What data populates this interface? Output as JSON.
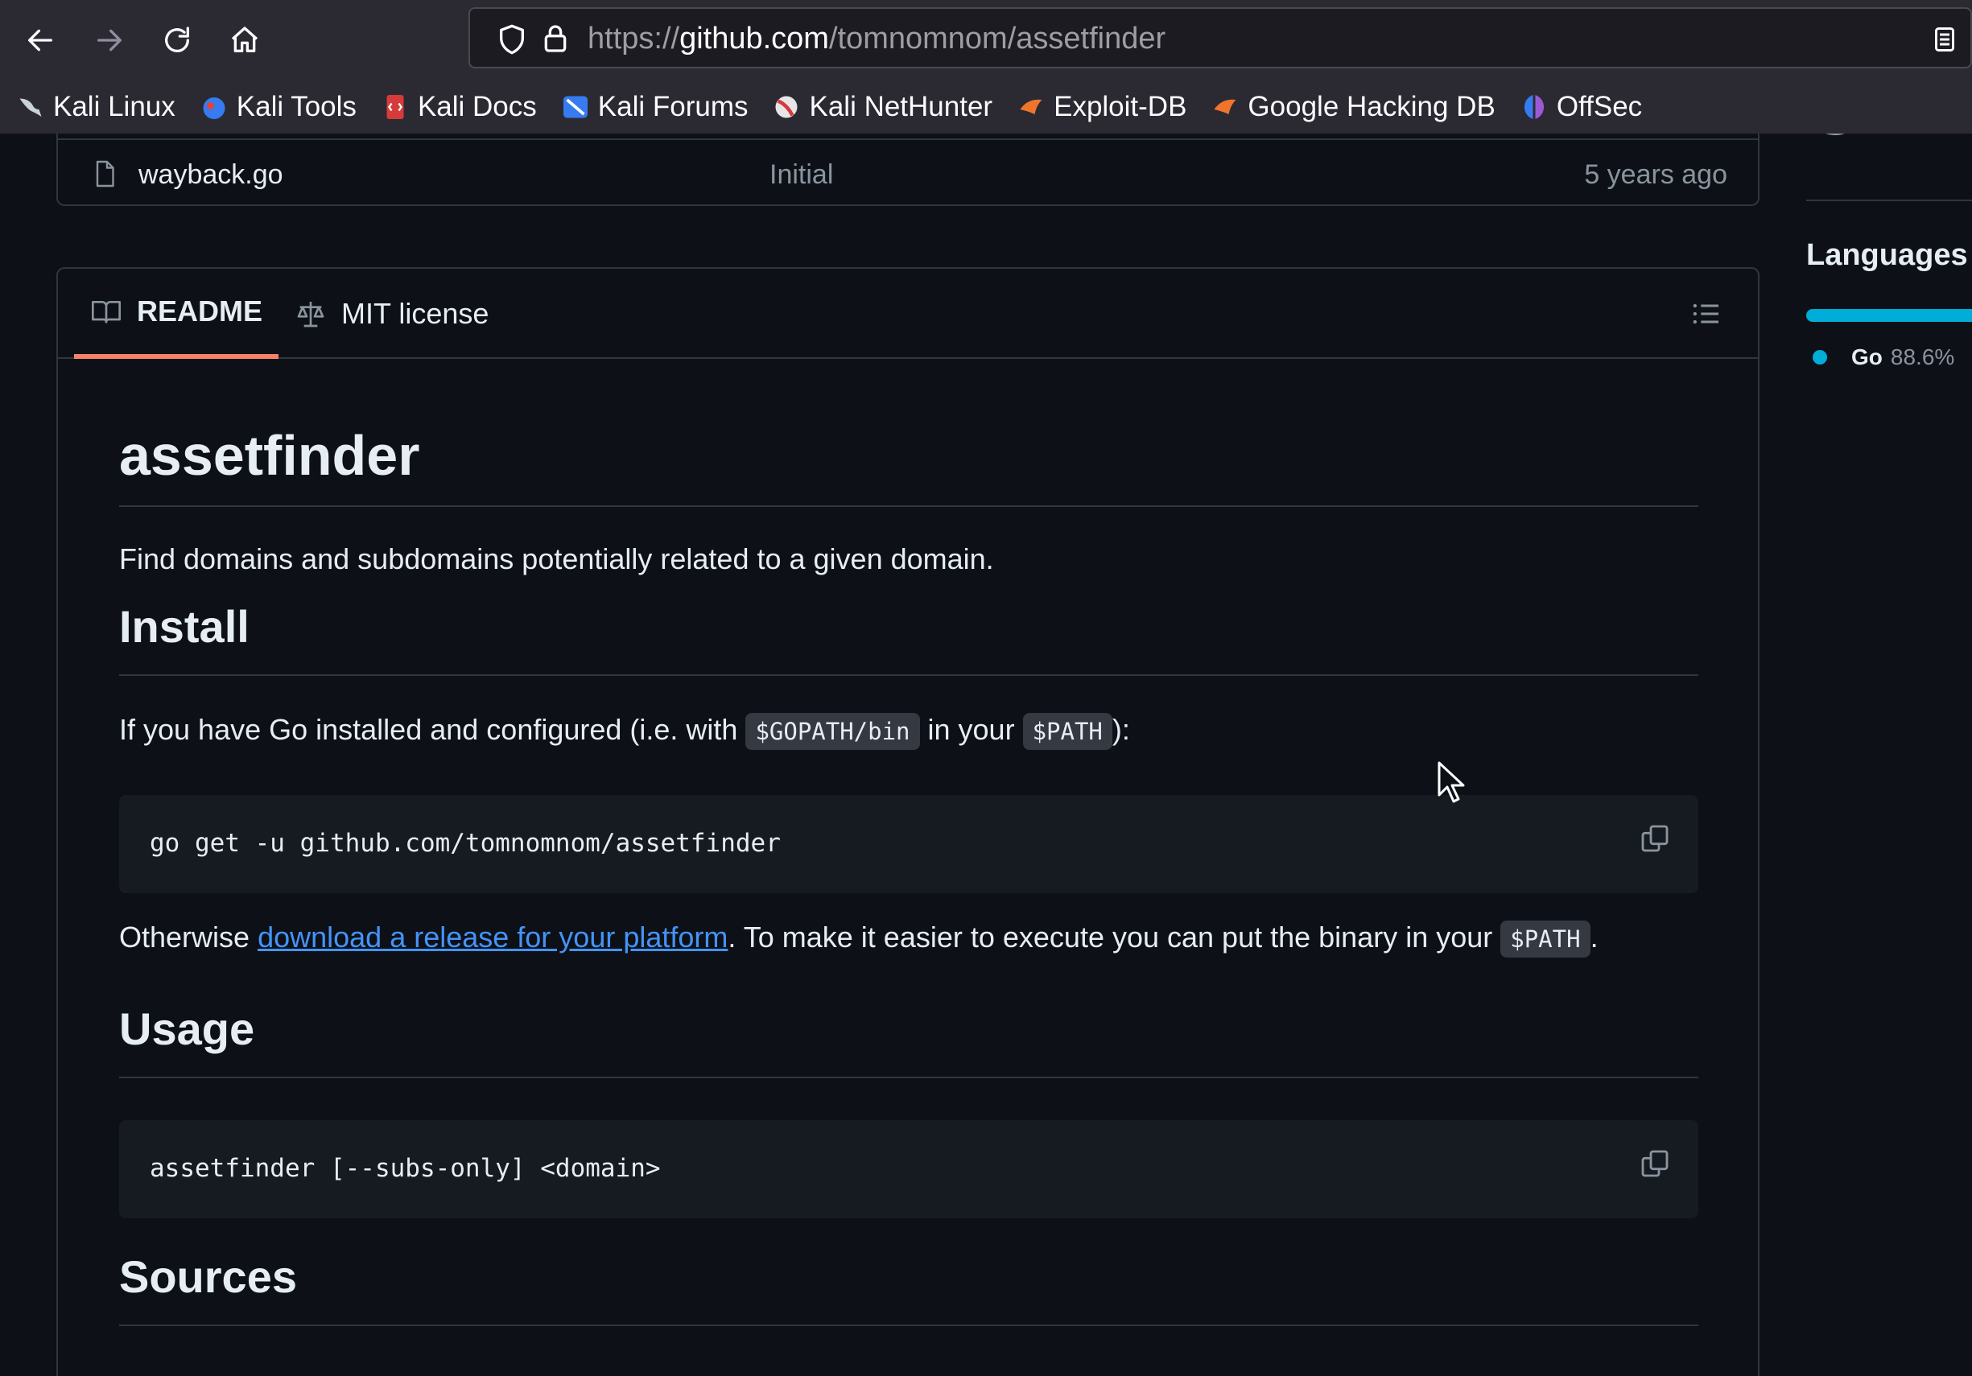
{
  "browser": {
    "url_prefix": "https://",
    "url_host": "github.com",
    "url_path": "/tomnomnom/assetfinder"
  },
  "bookmarks": [
    {
      "label": "Kali Linux",
      "icon": "kali-dragon-icon"
    },
    {
      "label": "Kali Tools",
      "icon": "kali-tools-icon"
    },
    {
      "label": "Kali Docs",
      "icon": "kali-docs-icon"
    },
    {
      "label": "Kali Forums",
      "icon": "kali-forums-icon"
    },
    {
      "label": "Kali NetHunter",
      "icon": "kali-nethunter-icon"
    },
    {
      "label": "Exploit-DB",
      "icon": "exploit-db-icon"
    },
    {
      "label": "Google Hacking DB",
      "icon": "ghdb-icon"
    },
    {
      "label": "OffSec",
      "icon": "offsec-icon"
    }
  ],
  "file_row": {
    "name": "wayback.go",
    "message": "Initial",
    "time": "5 years ago"
  },
  "tabs": {
    "readme": "README",
    "license": "MIT license"
  },
  "readme": {
    "title": "assetfinder",
    "description": "Find domains and subdomains potentially related to a given domain.",
    "install_heading": "Install",
    "install_text_1": "If you have Go installed and configured (i.e. with ",
    "install_code_1": "$GOPATH/bin",
    "install_text_2": " in your ",
    "install_code_2": "$PATH",
    "install_text_3": "):",
    "install_cmd": "go get -u github.com/tomnomnom/assetfinder",
    "otherwise_text_1": "Otherwise ",
    "otherwise_link": "download a release for your platform",
    "otherwise_text_2": ". To make it easier to execute you can put the binary in your ",
    "otherwise_code": "$PATH",
    "otherwise_text_3": ".",
    "usage_heading": "Usage",
    "usage_cmd": "assetfinder [--subs-only] <domain>",
    "sources_heading": "Sources"
  },
  "sidebar": {
    "languages_heading": "Languages",
    "languages": [
      {
        "name": "Go",
        "percent": "88.6%",
        "color": "#00add8"
      }
    ]
  }
}
